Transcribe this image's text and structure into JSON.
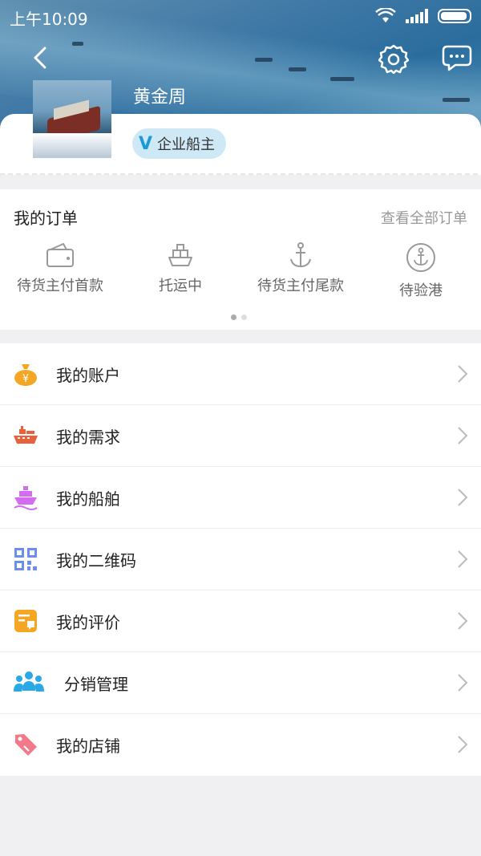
{
  "status_bar": {
    "time": "上午10:09"
  },
  "profile": {
    "name": "黄金周",
    "badge_mark": "V",
    "badge_label": "企业船主"
  },
  "orders": {
    "title": "我的订单",
    "view_all": "查看全部订单",
    "items": [
      {
        "label": "待货主付首款",
        "icon": "wallet-icon"
      },
      {
        "label": "托运中",
        "icon": "ship-icon"
      },
      {
        "label": "待货主付尾款",
        "icon": "anchor-icon"
      },
      {
        "label": "待验港",
        "icon": "anchor-circle-icon"
      }
    ],
    "page_indicator": {
      "pages": 2,
      "current": 1
    }
  },
  "menu": {
    "items": [
      {
        "label": "我的账户",
        "icon": "money-bag-icon",
        "color": "#f5a623"
      },
      {
        "label": "我的需求",
        "icon": "cargo-ship-icon",
        "color": "#e8603c"
      },
      {
        "label": "我的船舶",
        "icon": "boat-icon",
        "color": "#d36cf0"
      },
      {
        "label": "我的二维码",
        "icon": "qr-code-icon",
        "color": "#6b8ef0"
      },
      {
        "label": "我的评价",
        "icon": "review-icon",
        "color": "#f5a623"
      },
      {
        "label": "分销管理",
        "icon": "people-icon",
        "color": "#2aa9e6"
      },
      {
        "label": "我的店铺",
        "icon": "tag-icon",
        "color": "#f07a8a"
      }
    ]
  },
  "colors": {
    "accent": "#1a9ad6",
    "background": "#f0f0f2"
  }
}
